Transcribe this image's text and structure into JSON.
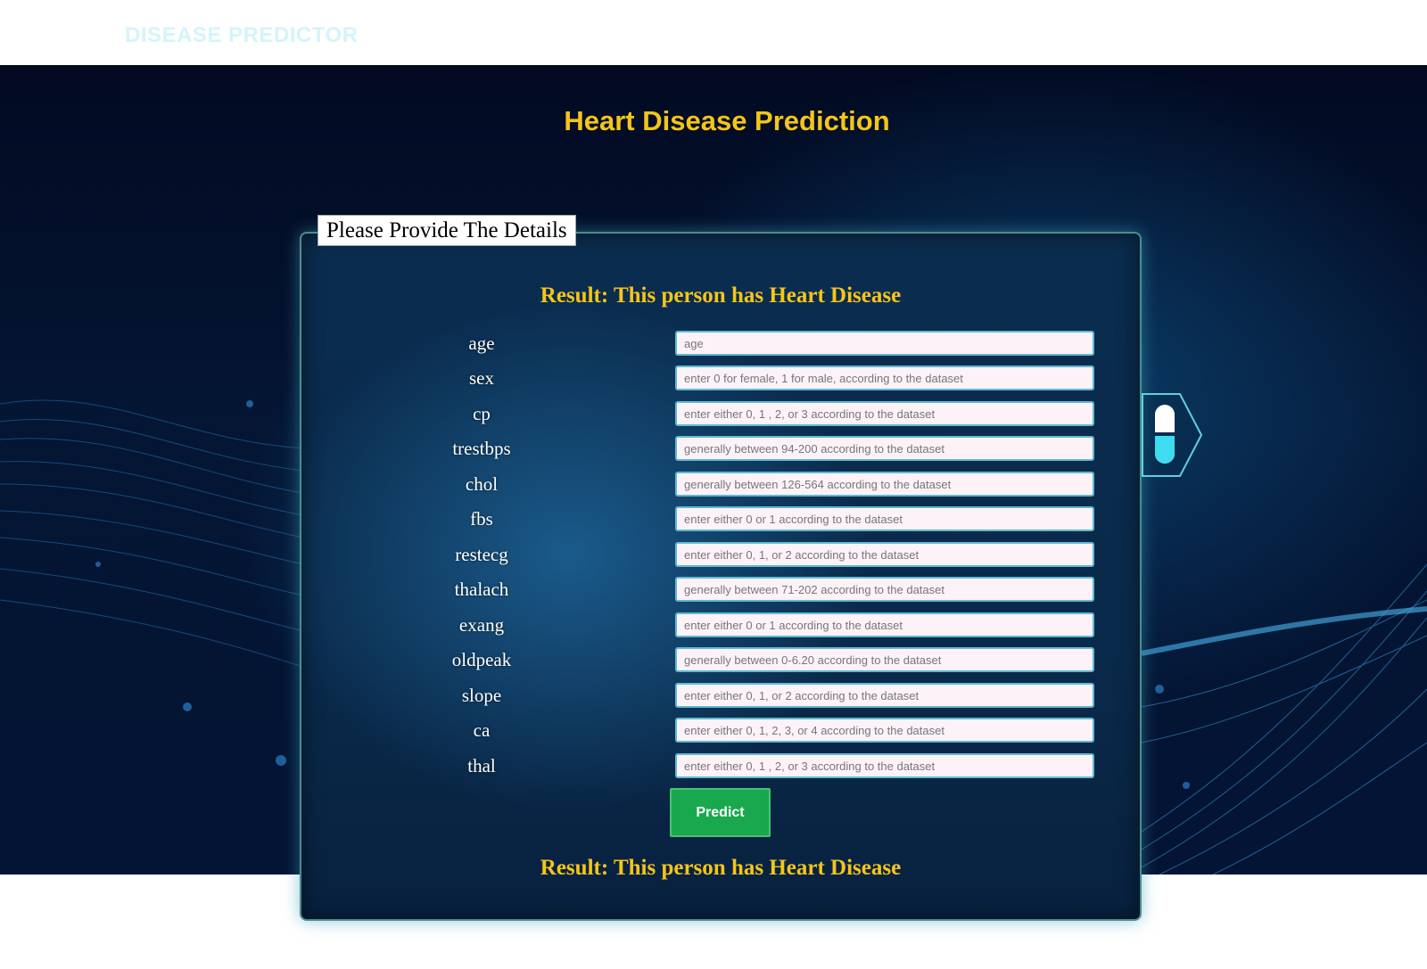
{
  "header": {
    "brand": "DISEASE PREDICTOR"
  },
  "page": {
    "title": "Heart Disease Prediction"
  },
  "form": {
    "legend": "Please Provide The Details",
    "result_top": "Result: This person has Heart Disease",
    "result_bottom": "Result: This person has Heart Disease",
    "submit_label": "Predict",
    "fields": [
      {
        "label": "age",
        "placeholder": "age",
        "value": ""
      },
      {
        "label": "sex",
        "placeholder": "enter 0 for female, 1 for male, according to the dataset",
        "value": ""
      },
      {
        "label": "cp",
        "placeholder": "enter either 0, 1 , 2, or 3 according to the dataset",
        "value": ""
      },
      {
        "label": "trestbps",
        "placeholder": "generally between 94-200 according to the dataset",
        "value": ""
      },
      {
        "label": "chol",
        "placeholder": "generally between 126-564 according to the dataset",
        "value": ""
      },
      {
        "label": "fbs",
        "placeholder": "enter either 0 or 1 according to the dataset",
        "value": ""
      },
      {
        "label": "restecg",
        "placeholder": "enter either 0, 1, or 2 according to the dataset",
        "value": ""
      },
      {
        "label": "thalach",
        "placeholder": "generally between 71-202 according to the dataset",
        "value": ""
      },
      {
        "label": "exang",
        "placeholder": "enter either 0 or 1 according to the dataset",
        "value": ""
      },
      {
        "label": "oldpeak",
        "placeholder": "generally between 0-6.20 according to the dataset",
        "value": ""
      },
      {
        "label": "slope",
        "placeholder": "enter either 0, 1, or 2 according to the dataset",
        "value": ""
      },
      {
        "label": "ca",
        "placeholder": "enter either 0, 1, 2, 3, or 4 according to the dataset",
        "value": ""
      },
      {
        "label": "thal",
        "placeholder": "enter either 0, 1 , 2, or 3 according to the dataset",
        "value": ""
      }
    ]
  },
  "side_widget": {
    "icon": "pill-icon"
  },
  "colors": {
    "title": "#f5c518",
    "result": "#f5c518",
    "button": "#1aa84e",
    "input_bg": "#fdf2f8",
    "input_border": "#5fbad0",
    "brand": "#d4f4fb"
  }
}
